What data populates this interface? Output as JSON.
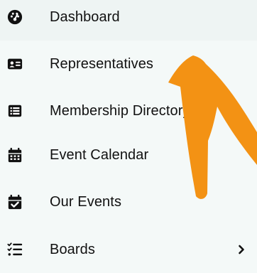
{
  "menu": {
    "items": [
      {
        "label": "Dashboard",
        "icon": "gauge-icon"
      },
      {
        "label": "Representatives",
        "icon": "id-card-icon"
      },
      {
        "label": "Membership Directory",
        "icon": "list-icon"
      },
      {
        "label": "Event Calendar",
        "icon": "calendar-icon"
      },
      {
        "label": "Our Events",
        "icon": "calendar-check-icon"
      },
      {
        "label": "Boards",
        "icon": "checklist-icon",
        "has_submenu": true
      }
    ]
  },
  "annotation": {
    "arrow_color": "#f39214",
    "icon": "arrow-annotation"
  },
  "colors": {
    "background": "#f4f9f8",
    "text": "#111111"
  }
}
